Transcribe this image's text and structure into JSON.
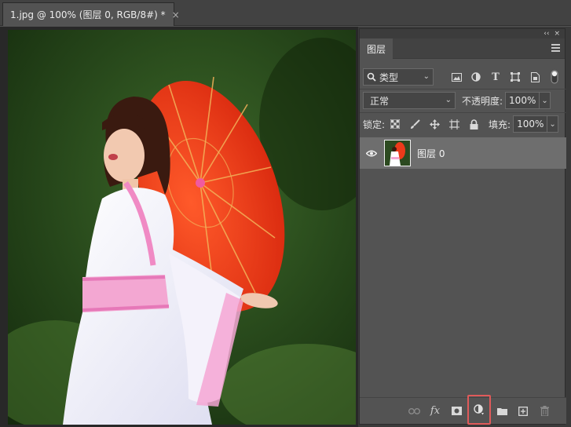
{
  "document": {
    "tab_title": "1.jpg @ 100% (图层 0, RGB/8#) *",
    "close_glyph": "×"
  },
  "layers_panel": {
    "collapse_glyph": "‹‹",
    "close_glyph": "×",
    "tab_label": "图层",
    "filter": {
      "value": "类型",
      "icon": "search-icon"
    },
    "filter_icons": [
      "image-filter-icon",
      "adjustment-filter-icon",
      "type-filter-icon",
      "shape-filter-icon",
      "smart-object-filter-icon",
      "filter-toggle-icon"
    ],
    "blend_mode": "正常",
    "opacity_label": "不透明度:",
    "opacity_value": "100%",
    "lock_label": "锁定:",
    "lock_icons": [
      "lock-transparent-pixels-icon",
      "lock-image-pixels-icon",
      "lock-position-icon",
      "lock-artboard-icon",
      "lock-all-icon"
    ],
    "fill_label": "填充:",
    "fill_value": "100%",
    "layers": [
      {
        "name": "图层 0",
        "visible": true,
        "selected": true
      }
    ],
    "bottom_icons": [
      "link-layers-icon",
      "layer-style-fx-icon",
      "layer-mask-icon",
      "adjustment-layer-icon",
      "group-folder-icon",
      "new-layer-icon",
      "delete-icon"
    ],
    "fx_text": "fx",
    "highlighted_icon": "adjustment-layer-icon",
    "highlight_color": "#e05a5a"
  },
  "colors": {
    "ui_background": "#535353",
    "selected_layer": "#6e6e6e",
    "parasol": "#ec3a1a"
  }
}
